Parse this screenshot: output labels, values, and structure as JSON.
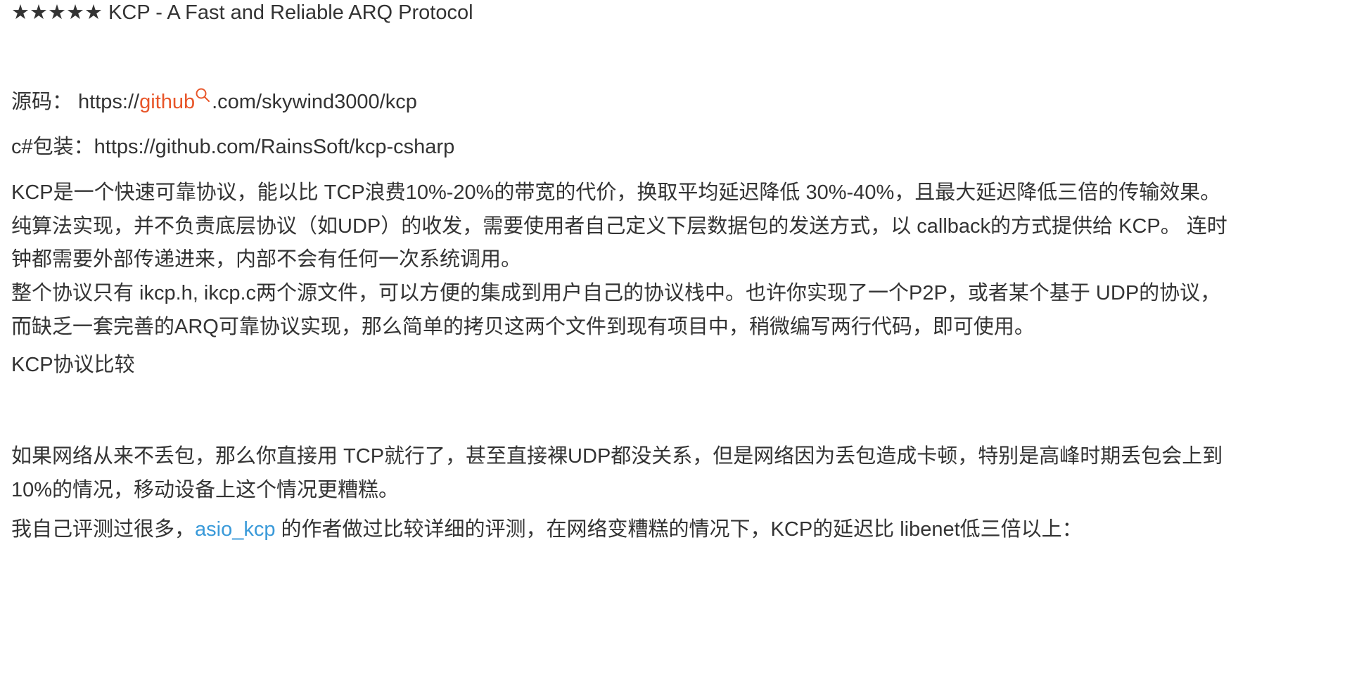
{
  "title": "★★★★★ KCP - A Fast and Reliable ARQ Protocol",
  "source_line": {
    "prefix": "源码： https://",
    "keyword": "github",
    "suffix": ".com/skywind3000/kcp"
  },
  "csharp_line": "c#包装：https://github.com/RainsSoft/kcp-csharp",
  "intro_para": [
    "KCP是一个快速可靠协议，能以比 TCP浪费10%-20%的带宽的代价，换取平均延迟降低 30%-40%，且最大延迟降低三倍的传输效果。",
    "纯算法实现，并不负责底层协议（如UDP）的收发，需要使用者自己定义下层数据包的发送方式，以 callback的方式提供给 KCP。 连时",
    "钟都需要外部传递进来，内部不会有任何一次系统调用。"
  ],
  "files_para": [
    "整个协议只有 ikcp.h, ikcp.c两个源文件，可以方便的集成到用户自己的协议栈中。也许你实现了一个P2P，或者某个基于 UDP的协议，",
    "而缺乏一套完善的ARQ可靠协议实现，那么简单的拷贝这两个文件到现有项目中，稍微编写两行代码，即可使用。"
  ],
  "compare_heading": "KCP协议比较",
  "network_para": [
    "如果网络从来不丢包，那么你直接用 TCP就行了，甚至直接裸UDP都没关系，但是网络因为丢包造成卡顿，特别是高峰时期丢包会上到",
    "10%的情况，移动设备上这个情况更糟糕。"
  ],
  "eval_line": {
    "prefix": "我自己评测过很多，",
    "link": "asio_kcp",
    "suffix": " 的作者做过比较详细的评测，在网络变糟糕的情况下，KCP的延迟比 libenet低三倍以上："
  },
  "colors": {
    "text": "#333333",
    "keyword_orange": "#e8562a",
    "link_blue": "#3a9ad9"
  },
  "icons": {
    "search": "search-icon"
  }
}
